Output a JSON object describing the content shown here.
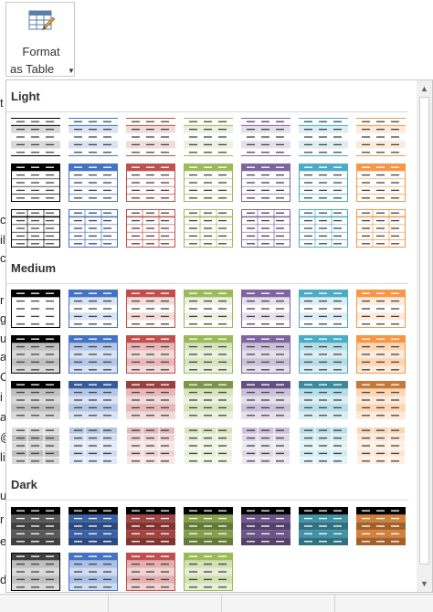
{
  "ribbon": {
    "label_line1": "Format",
    "label_line2": "as Table",
    "icon": "table-format-icon",
    "dropdown_icon": "caret-down-icon"
  },
  "gallery": {
    "sections": [
      {
        "title": "Light",
        "rows": 3
      },
      {
        "title": "Medium",
        "rows": 4
      },
      {
        "title": "Dark",
        "rows": 2
      }
    ]
  },
  "colors": {
    "none": "#000000",
    "blue": "#4472c4",
    "red": "#c0504d",
    "green": "#9bbb59",
    "purple": "#8064a2",
    "aqua": "#4bacc6",
    "orange": "#f79646"
  },
  "sheet_chars": [
    "t",
    "c",
    "il",
    "c",
    "r",
    "gi",
    "u",
    "ai",
    "O",
    "i",
    "a",
    "@",
    "li",
    "u",
    "r",
    "e",
    "d"
  ]
}
